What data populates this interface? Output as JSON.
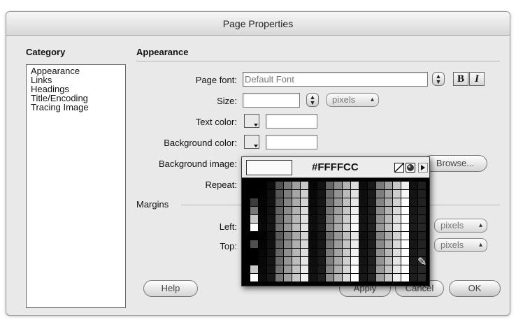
{
  "window": {
    "title": "Page Properties"
  },
  "category": {
    "header": "Category",
    "items": [
      "Appearance",
      "Links",
      "Headings",
      "Title/Encoding",
      "Tracing Image"
    ]
  },
  "panel": {
    "header": "Appearance",
    "page_font_label": "Page font:",
    "page_font_value": "Default Font",
    "bold_label": "B",
    "italic_label": "I",
    "size_label": "Size:",
    "size_value": "",
    "size_unit": "pixels",
    "text_color_label": "Text color:",
    "text_color_value": "",
    "bg_color_label": "Background color:",
    "bg_color_value": "",
    "bg_image_label": "Background image:",
    "browse_label": "Browse...",
    "repeat_label": "Repeat:",
    "margins_header": "Margins",
    "left_label": "Left:",
    "left_unit": "pixels",
    "top_label": "Top:",
    "top_unit": "pixels"
  },
  "buttons": {
    "help": "Help",
    "apply": "Apply",
    "cancel": "Cancel",
    "ok": "OK"
  },
  "color_picker": {
    "hex": "#FFFFCC",
    "preview_color": "#FAFAFA",
    "icons": [
      "no-color-icon",
      "system-color-wheel-icon",
      "palette-menu-arrow-icon"
    ]
  }
}
